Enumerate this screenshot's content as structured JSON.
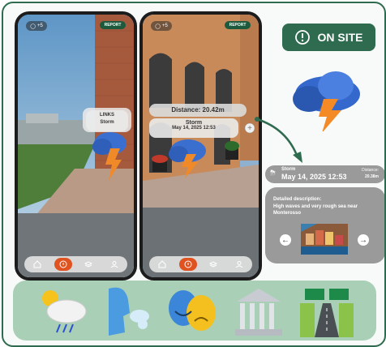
{
  "phone1": {
    "count_badge": "+5",
    "report_label": "REPORT",
    "tag_line1": "LINKS",
    "tag_line2": "Storm"
  },
  "phone2": {
    "count_badge": "+5",
    "report_label": "REPORT",
    "distance": "Distance: 20.42m",
    "storm_title": "Storm",
    "storm_date": "May 14, 2025 12:53"
  },
  "on_site_label": "ON SITE",
  "alert": {
    "title": "Storm",
    "date": "May 14, 2025 12:53",
    "distance_label": "Distance:",
    "distance_value": "20.38m"
  },
  "detail": {
    "heading": "Detailed description:",
    "text": "High waves and very rough sea near Monterosso"
  },
  "colors": {
    "accent_green": "#2e6b4f",
    "strip_green": "#a9d0b7",
    "report_orange": "#e0521f"
  },
  "bottom_icons": [
    "storm-icon",
    "wind-face-icon",
    "theatre-masks-icon",
    "museum-icon",
    "road-icon"
  ],
  "tabbar_icons": [
    "home-icon",
    "alert-icon",
    "layers-icon",
    "profile-icon"
  ]
}
